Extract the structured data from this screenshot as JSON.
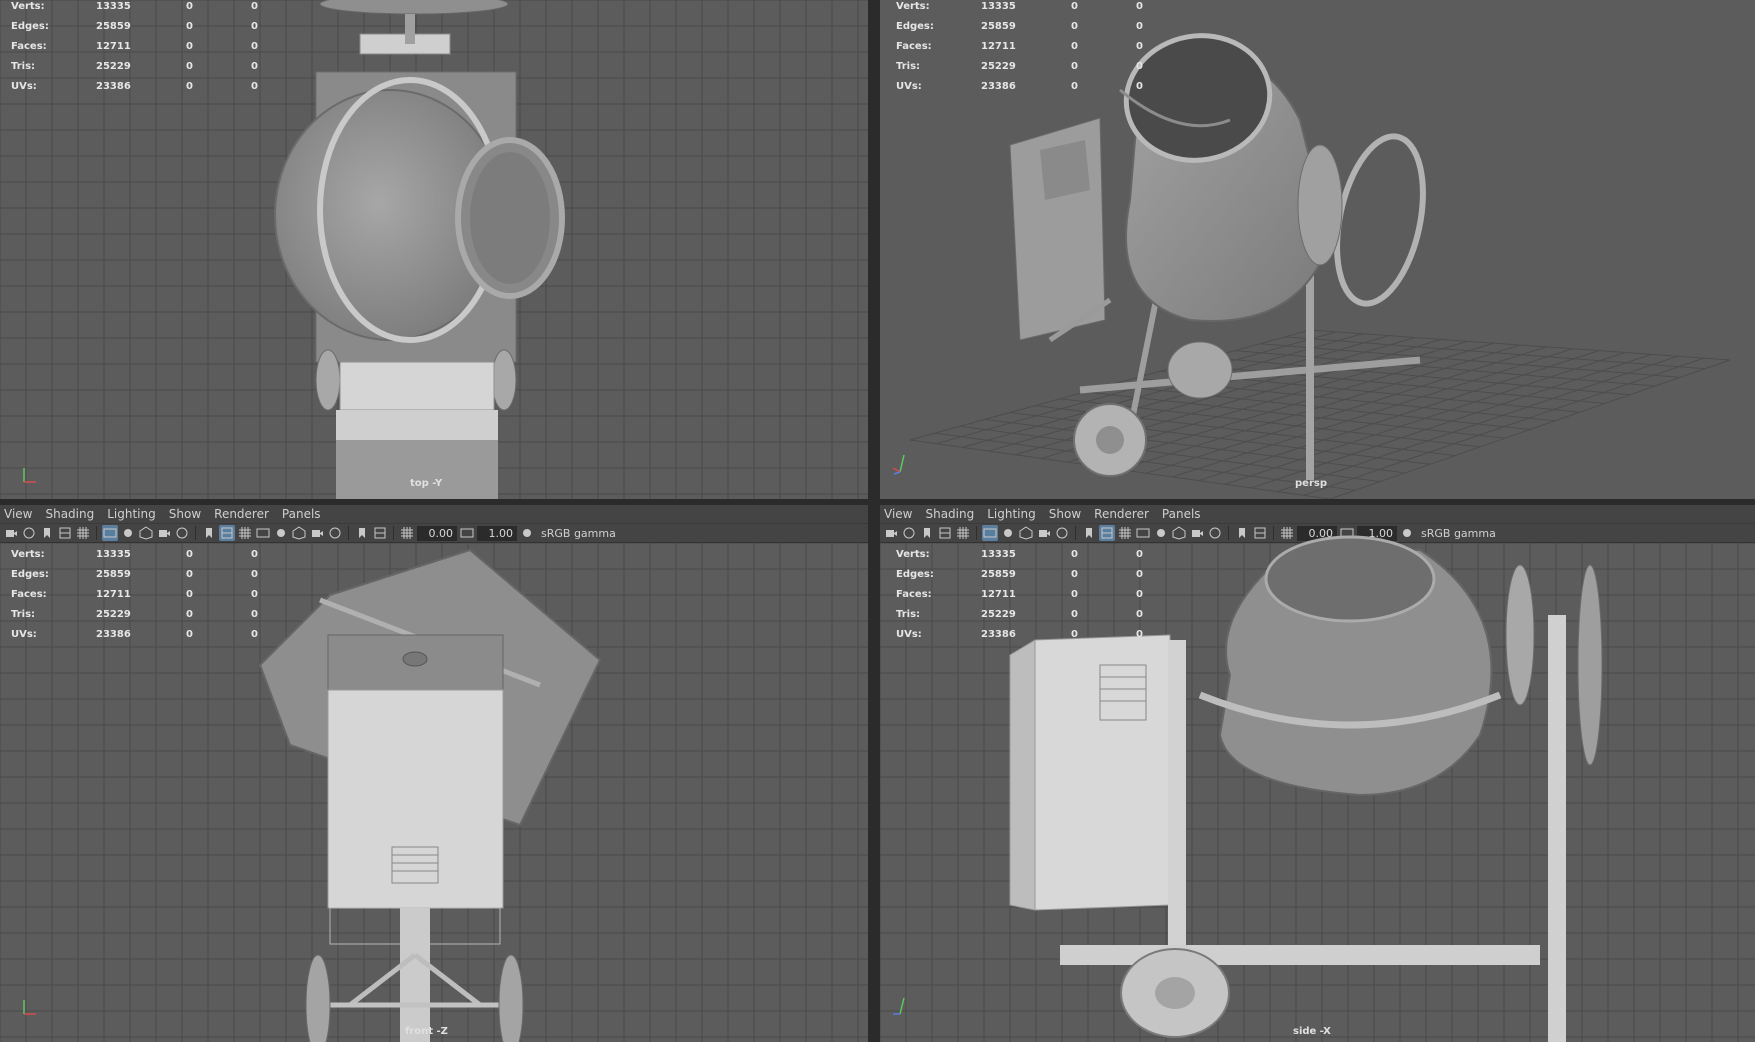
{
  "stats": {
    "labels": [
      "Verts:",
      "Edges:",
      "Faces:",
      "Tris:",
      "UVs:"
    ],
    "values": [
      "13335",
      "25859",
      "12711",
      "25229",
      "23386"
    ],
    "zeros": "0"
  },
  "menu": [
    "View",
    "Shading",
    "Lighting",
    "Show",
    "Renderer",
    "Panels"
  ],
  "toolbar": {
    "exposure": "0.00",
    "gamma": "1.00",
    "color_space": "sRGB gamma"
  },
  "cameras": {
    "top": "top -Y",
    "persp": "persp",
    "front": "front -Z",
    "side": "side -X"
  },
  "icons": [
    "camera-icon",
    "camera-attr-icon",
    "bookmark-icon",
    "image-plane-icon",
    "grid-icon",
    "film-gate-icon",
    "resolution-gate-icon",
    "gate-mask-icon",
    "field-chart-icon",
    "safe-action-icon",
    "wireframe-icon",
    "smooth-shade-icon",
    "default-material-icon",
    "textured-icon",
    "use-lights-icon",
    "shadows-icon",
    "ambient-occlusion-icon",
    "motion-blur-icon",
    "isolate-icon",
    "xray-icon",
    "exposure-icon",
    "gamma-icon",
    "color-management-icon"
  ],
  "colors": {
    "viewport_bg": "#5c5c5c",
    "grid": "#4a4a4a",
    "grid_center": "#2f2f2f",
    "panel_bar": "#444444",
    "model": "#b9b9b9",
    "active_icon": "#5a7f9e"
  }
}
